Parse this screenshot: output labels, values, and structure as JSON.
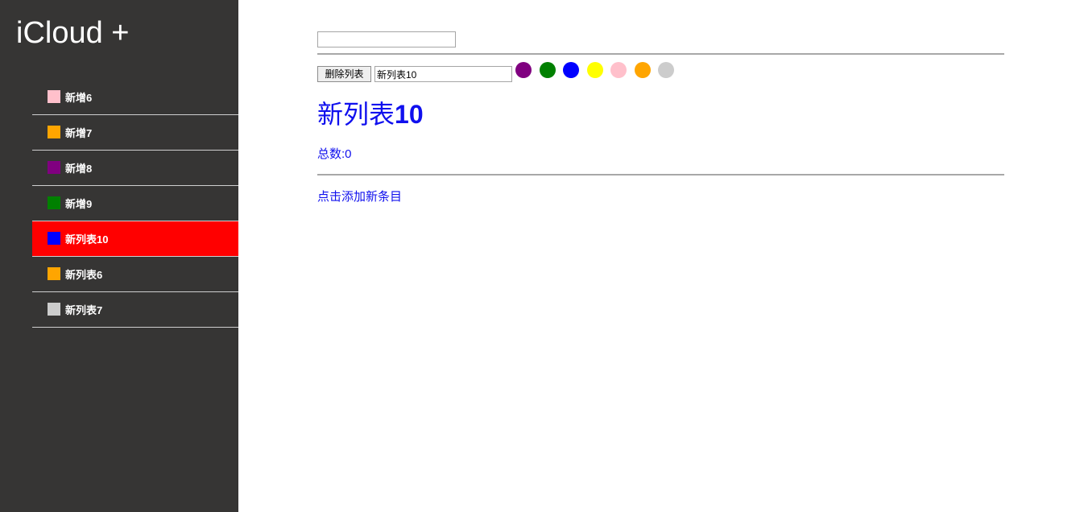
{
  "sidebar": {
    "title": "iCloud +",
    "lists": [
      {
        "label": "新增6",
        "color": "#ffc0cb",
        "active": false
      },
      {
        "label": "新增7",
        "color": "#ffa500",
        "active": false
      },
      {
        "label": "新增8",
        "color": "#800080",
        "active": false
      },
      {
        "label": "新增9",
        "color": "#008000",
        "active": false
      },
      {
        "label": "新列表10",
        "color": "#0000ff",
        "active": true
      },
      {
        "label": "新列表6",
        "color": "#ffa500",
        "active": false
      },
      {
        "label": "新列表7",
        "color": "#cccccc",
        "active": false
      }
    ],
    "active_color": "#ff0000"
  },
  "main": {
    "search": {
      "value": "",
      "placeholder": ""
    },
    "toolbar": {
      "delete_label": "删除列表",
      "name_value": "新列表10",
      "colors": [
        {
          "name": "purple",
          "hex": "#800080"
        },
        {
          "name": "green",
          "hex": "#008000"
        },
        {
          "name": "blue",
          "hex": "#0000ff"
        },
        {
          "name": "yellow",
          "hex": "#ffff00"
        },
        {
          "name": "pink",
          "hex": "#ffc0cb"
        },
        {
          "name": "orange",
          "hex": "#ffa500"
        },
        {
          "name": "lightgray",
          "hex": "#cccccc"
        }
      ]
    },
    "heading": {
      "name": "新列表",
      "number": "10"
    },
    "count_text": "总数:0",
    "add_link": "点击添加新条目",
    "accent_color": "#1010ee"
  }
}
